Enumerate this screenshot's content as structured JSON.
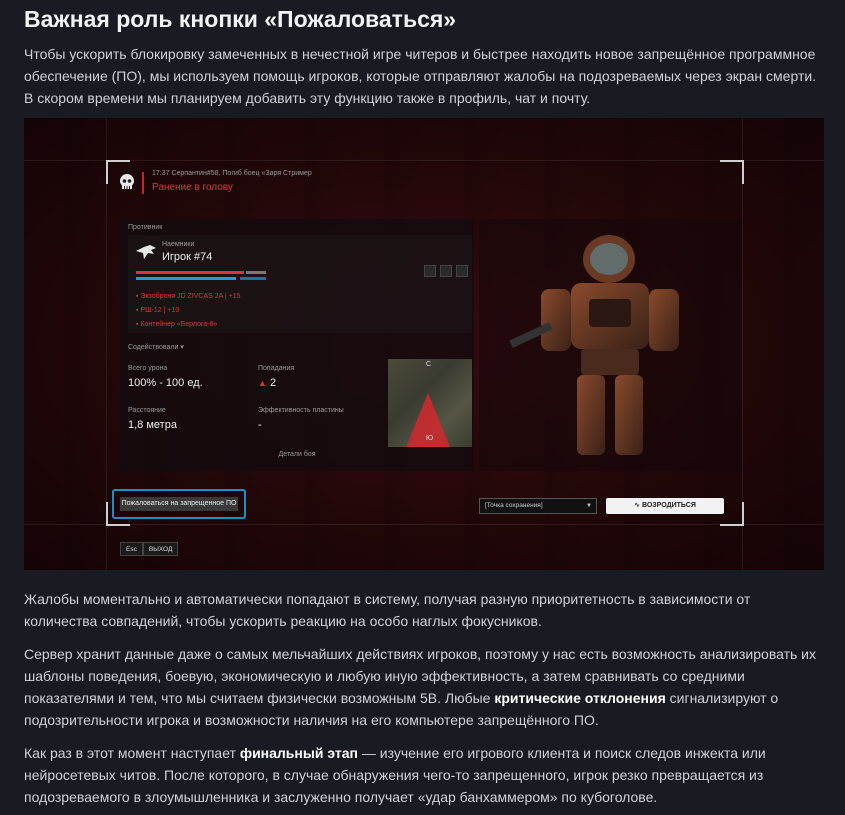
{
  "article": {
    "title": "Важная роль кнопки «Пожаловаться»",
    "intro": "Чтобы ускорить блокировку замеченных в нечестной игре читеров и быстрее находить новое запрещённое программное обеспечение (ПО), мы используем помощь игроков, которые отправляют жалобы на подозреваемых через экран смерти. В скором времени мы планируем добавить эту функцию также в профиль, чат и почту.",
    "p2": "Жалобы моментально и автоматически попадают в систему, получая разную приоритетность в зависимости от количества совпадений, чтобы ускорить реакцию на особо наглых фокусников.",
    "p3_start": "Сервер хранит данные даже о самых мельчайших действиях игроков, поэтому у нас есть возможность анализировать их шаблоны поведения, боевую, экономическую и любую иную эффективность, а затем сравнивать со средними показателями и тем, что мы считаем физически возможным 5В. Любые ",
    "p3_bold": "критические отклонения",
    "p3_end": " сигнализируют о подозрительности игрока и возможности наличия на его компьютере запрещённого ПО.",
    "p4_start": "Как раз в этот момент наступает ",
    "p4_bold": "финальный этап",
    "p4_end": " — изучение его игрового клиента и поиск следов инжекта или нейросетевых читов. После которого, в случае обнаружения чего-то запрещенного, игрок резко превращается из подозреваемого в злоумышленника и заслуженно получает «удар банхаммером» по кубоголове."
  },
  "death_screen": {
    "meta": "17:37 Серпантин#58. Погиб боец «Заря Стример",
    "cause": "Ранение в голову",
    "opponent_label": "Противник",
    "faction": "Наемники",
    "player_name": "Игрок #74",
    "gear": [
      "Экзоброня JD ZIVCAS 2A | +15",
      "РШ-12 | +10",
      "Контейнер «Берлога-6»"
    ],
    "assist_label": "Содействовали",
    "stats": [
      {
        "label": "Всего урона",
        "value": "100% - 100 ед."
      },
      {
        "label": "Попадания",
        "value": "2"
      },
      {
        "label": "Расстояние",
        "value": "1,8 метра"
      },
      {
        "label": "Эффективность пластины",
        "value": "-"
      }
    ],
    "compass": {
      "north": "С",
      "south": "Ю"
    },
    "details_label": "Детали боя",
    "report_button": "Пожаловаться на запрещенное ПО",
    "save_point": "[Точка сохранения]",
    "respawn_button": "ВОЗРОДИТЬСЯ",
    "esc_key": "Esc",
    "exit_label": "ВЫХОД"
  },
  "colors": {
    "accent_red": "#e0353d",
    "report_border": "#1c8fc9",
    "bg": "#181b22"
  }
}
